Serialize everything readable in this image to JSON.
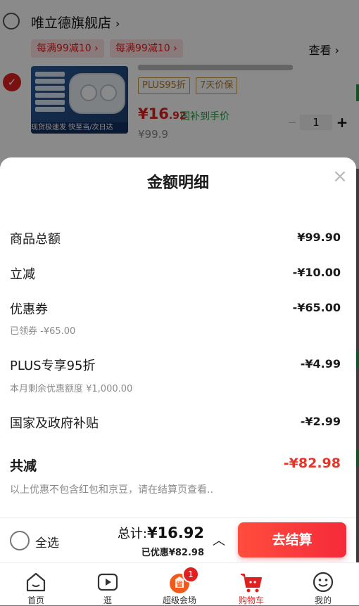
{
  "shop": {
    "name": "唯立德旗舰店",
    "promos": [
      "每满99减10",
      "每满99减10"
    ],
    "view_label": "查看"
  },
  "product": {
    "tags": [
      "PLUS95折",
      "7天价保"
    ],
    "price_main": "¥16",
    "price_decimal": ".92",
    "subsidy_text": "国补到手价",
    "original_price": "¥99.9",
    "quantity": "1",
    "minus": "−",
    "plus": "+",
    "thumb_caption": "现货极速发  快至当/次日达"
  },
  "sheet": {
    "title": "金额明细",
    "rows": [
      {
        "label": "商品总额",
        "value": "¥99.90"
      },
      {
        "label": "立减",
        "value": "-¥10.00"
      },
      {
        "label": "优惠券",
        "value": "-¥65.00",
        "sub": "已领券 -¥65.00"
      },
      {
        "label": "PLUS专享95折",
        "value": "-¥4.99",
        "sub": "本月剩余优惠额度 ¥1,000.00"
      },
      {
        "label": "国家及政府补贴",
        "value": "-¥2.99"
      }
    ],
    "total_label": "共减",
    "total_value": "-¥82.98",
    "note": "以上优惠不包含红包和京豆，请在结算页查看.."
  },
  "checkout": {
    "select_all": "全选",
    "total_prefix": "总计:",
    "total_amount": "¥16.92",
    "discount_text": "已优惠¥82.98",
    "pay_button": "去结算"
  },
  "tabs": [
    {
      "label": "首页",
      "icon": "home-icon"
    },
    {
      "label": "逛",
      "icon": "play-icon"
    },
    {
      "label": "超级会场",
      "icon": "venue-icon",
      "badge": "1"
    },
    {
      "label": "购物车",
      "icon": "cart-icon",
      "active": true
    },
    {
      "label": "我的",
      "icon": "smile-icon"
    }
  ],
  "colors": {
    "accent": "#e02020",
    "pay_gradient_start": "#ff4d3d",
    "pay_gradient_end": "#f52a3a",
    "subsidy_green": "#1a9a3a"
  }
}
